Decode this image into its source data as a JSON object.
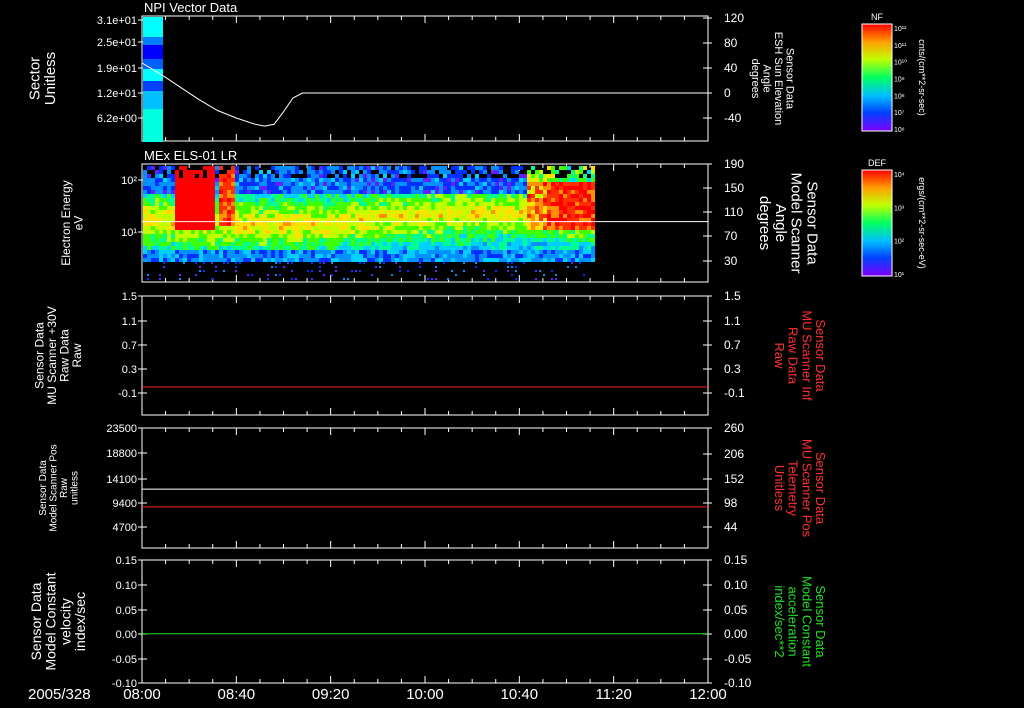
{
  "chart_data": [
    {
      "type": "line",
      "title": "NPI Vector Data",
      "ylabel_left": [
        "Sector",
        "Unitless"
      ],
      "yticks_left": [
        "3.1e+01",
        "2.5e+01",
        "1.9e+01",
        "1.2e+01",
        "6.2e+00"
      ],
      "ylabel_right": [
        "Sensor Data",
        "ESH Sun Elevation",
        "Angle",
        "degrees"
      ],
      "yticks_right": [
        "120",
        "80",
        "40",
        "0",
        "-40"
      ],
      "ylim_right": [
        -80,
        120
      ],
      "series": [
        {
          "name": "ESH Sun Elevation Angle",
          "color": "#ffffff",
          "x": [
            "08:00",
            "08:08",
            "08:16",
            "08:24",
            "08:32",
            "08:40",
            "08:48",
            "08:52",
            "08:56",
            "09:00",
            "09:04",
            "09:08",
            "09:12",
            "09:20",
            "10:00",
            "10:40",
            "11:20",
            "12:00"
          ],
          "values": [
            48,
            30,
            10,
            -10,
            -28,
            -40,
            -50,
            -53,
            -50,
            -30,
            -8,
            0,
            0,
            0,
            0,
            0,
            0,
            0
          ]
        }
      ],
      "colorbar": {
        "label": "NF",
        "units": "cnts/(cm**2-sr-sec)",
        "ticks": [
          "10¹²",
          "10¹¹",
          "10¹⁰",
          "10⁹",
          "10⁸",
          "10⁷",
          "10⁶"
        ]
      }
    },
    {
      "type": "heatmap",
      "title": "MEx ELS-01 LR",
      "ylabel_left": [
        "Electron Energy",
        "eV"
      ],
      "yticks_left": [
        "10²",
        "10¹"
      ],
      "ylabel_right": [
        "Sensor Data",
        "Model Scanner",
        "Angle",
        "degrees"
      ],
      "yticks_right": [
        "190",
        "150",
        "110",
        "70",
        "30"
      ],
      "ylim_right": [
        0,
        190
      ],
      "series": [
        {
          "name": "Model Scanner Angle",
          "color": "#ffffff",
          "x": [
            "08:00",
            "12:00"
          ],
          "values": [
            95,
            95
          ]
        }
      ],
      "colorbar": {
        "label": "DEF",
        "units": "ergs/(cm**2-sr-sec-eV)",
        "ticks": [
          "10⁴",
          "10³",
          "10²",
          "10¹"
        ]
      }
    },
    {
      "type": "line",
      "ylabel_left": [
        "Sensor Data",
        "MU Scanner +30V",
        "Raw Data",
        "Raw"
      ],
      "yticks_left": [
        "1.5",
        "1.1",
        "0.7",
        "0.3",
        "-0.1"
      ],
      "ylim_left": [
        -0.3,
        1.5
      ],
      "ylabel_right": [
        "Sensor Data",
        "MU Scanner Inf",
        "Raw Data",
        "Raw"
      ],
      "yticks_right": [
        "1.5",
        "1.1",
        "0.7",
        "0.3",
        "-0.1"
      ],
      "ylim_right": [
        -0.3,
        1.5
      ],
      "series": [
        {
          "name": "MU Scanner Inf Raw Data",
          "color": "#ff2020",
          "x": [
            "08:00",
            "12:00"
          ],
          "values": [
            0.0,
            0.0
          ]
        }
      ]
    },
    {
      "type": "line",
      "ylabel_left": [
        "Sensor Data",
        "Model Scanner Pos",
        "Raw",
        "unitless"
      ],
      "yticks_left": [
        "23500",
        "18800",
        "14100",
        "9400",
        "4700"
      ],
      "ylim_left": [
        0,
        23500
      ],
      "ylabel_right": [
        "Sensor Data",
        "MU Scanner Pos",
        "Telemetry",
        "Unitless"
      ],
      "yticks_right": [
        "260",
        "206",
        "152",
        "98",
        "44"
      ],
      "ylim_right": [
        0,
        260
      ],
      "series": [
        {
          "name": "Model Scanner Pos",
          "color": "#ffffff",
          "x": [
            "08:00",
            "12:00"
          ],
          "values": [
            11900,
            11900
          ]
        },
        {
          "name": "MU Scanner Pos Telemetry",
          "color": "#ff2020",
          "x": [
            "08:00",
            "12:00"
          ],
          "values": [
            88,
            88
          ]
        }
      ]
    },
    {
      "type": "line",
      "ylabel_left": [
        "Sensor Data",
        "Model Constant",
        "velocity",
        "index/sec"
      ],
      "yticks_left": [
        "0.15",
        "0.10",
        "0.05",
        "0.00",
        "-0.05",
        "-0.10"
      ],
      "ylim_left": [
        -0.1,
        0.15
      ],
      "ylabel_right": [
        "Sensor Data",
        "Model Constant",
        "acceleration",
        "index/sec**2"
      ],
      "yticks_right": [
        "0.15",
        "0.10",
        "0.05",
        "0.00",
        "-0.05",
        "-0.10"
      ],
      "ylim_right": [
        -0.1,
        0.15
      ],
      "series": [
        {
          "name": "Model Constant acceleration",
          "color": "#20e020",
          "x": [
            "08:00",
            "12:00"
          ],
          "values": [
            0.0,
            0.0
          ]
        }
      ]
    }
  ],
  "x_axis": {
    "date": "2005/328",
    "ticks": [
      "08:00",
      "08:40",
      "09:20",
      "10:00",
      "10:40",
      "11:20",
      "12:00"
    ]
  }
}
